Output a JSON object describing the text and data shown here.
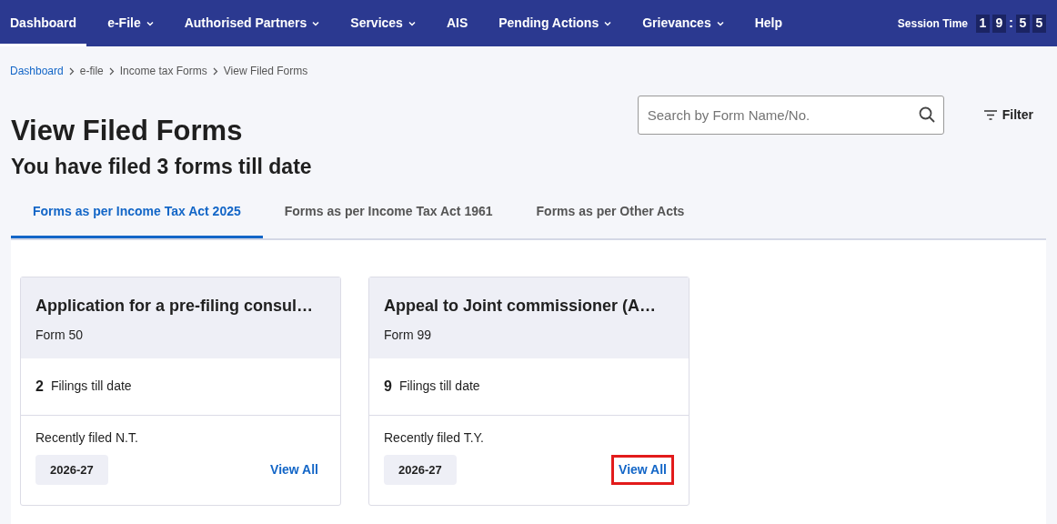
{
  "nav": {
    "items": [
      {
        "label": "Dashboard",
        "selected": true,
        "dropdown": false
      },
      {
        "label": "e-File",
        "selected": false,
        "dropdown": true
      },
      {
        "label": "Authorised Partners",
        "selected": false,
        "dropdown": true
      },
      {
        "label": "Services",
        "selected": false,
        "dropdown": true
      },
      {
        "label": "AIS",
        "selected": false,
        "dropdown": false
      },
      {
        "label": "Pending Actions",
        "selected": false,
        "dropdown": true
      },
      {
        "label": "Grievances",
        "selected": false,
        "dropdown": true
      },
      {
        "label": "Help",
        "selected": false,
        "dropdown": false
      }
    ],
    "session": {
      "label": "Session Time",
      "digits": [
        {
          "text": "1",
          "kind": "digit"
        },
        {
          "text": "9",
          "kind": "digit"
        },
        {
          "text": ":",
          "kind": "separator"
        },
        {
          "text": "5",
          "kind": "digit"
        },
        {
          "text": "5",
          "kind": "digit"
        }
      ]
    }
  },
  "breadcrumb": [
    {
      "label": "Dashboard",
      "link": true
    },
    {
      "label": "e-file",
      "link": false
    },
    {
      "label": "Income tax Forms",
      "link": false
    },
    {
      "label": "View Filed Forms",
      "link": false
    }
  ],
  "title": "View Filed Forms",
  "subtitle": "You have filed 3 forms till date",
  "search": {
    "placeholder": "Search by Form Name/No."
  },
  "filter": "Filter",
  "tabs": [
    {
      "label": "Forms as per Income Tax Act 2025",
      "selected": true
    },
    {
      "label": "Forms as per Income Tax Act 1961",
      "selected": false
    },
    {
      "label": "Forms as per Other Acts",
      "selected": false
    }
  ],
  "cards": [
    {
      "title": "Application for a pre-filing consul…",
      "form": "Form 50",
      "count": "2",
      "count_label": "Filings till date",
      "recent_label": "Recently filed N.T.",
      "year": "2026-27",
      "link": "View All",
      "highlighted": false
    },
    {
      "title": "Appeal to Joint commissioner (A…",
      "form": "Form 99",
      "count": "9",
      "count_label": "Filings till date",
      "recent_label": "Recently filed T.Y.",
      "year": "2026-27",
      "link": "View All",
      "highlighted": true
    }
  ]
}
